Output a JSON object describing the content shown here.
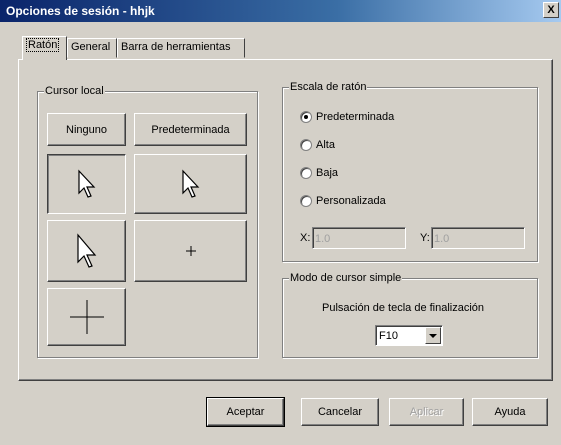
{
  "window": {
    "title": "Opciones de sesión - hhjk",
    "close_label": "X"
  },
  "tabs": [
    {
      "label": "Ratón",
      "active": true
    },
    {
      "label": "General",
      "active": false
    },
    {
      "label": "Barra de herramientas",
      "active": false
    }
  ],
  "cursor_local": {
    "legend": "Cursor local",
    "none_label": "Ninguno",
    "default_label": "Predeterminada",
    "selected_option": "Predeterminada"
  },
  "mouse_scale": {
    "legend": "Escala de ratón",
    "options": [
      "Predeterminada",
      "Alta",
      "Baja",
      "Personalizada"
    ],
    "selected": "Predeterminada",
    "x_label": "X:",
    "x_value": "1.0",
    "y_label": "Y:",
    "y_value": "1.0"
  },
  "simple_cursor": {
    "legend": "Modo de cursor simple",
    "key_label": "Pulsación de tecla de finalización",
    "key_value": "F10"
  },
  "footer": {
    "accept": "Aceptar",
    "cancel": "Cancelar",
    "apply": "Aplicar",
    "help": "Ayuda"
  },
  "colors": {
    "title_bar_start": "#0a246a",
    "title_bar_end": "#a6caf0",
    "window_bg": "#d4d0c8"
  }
}
